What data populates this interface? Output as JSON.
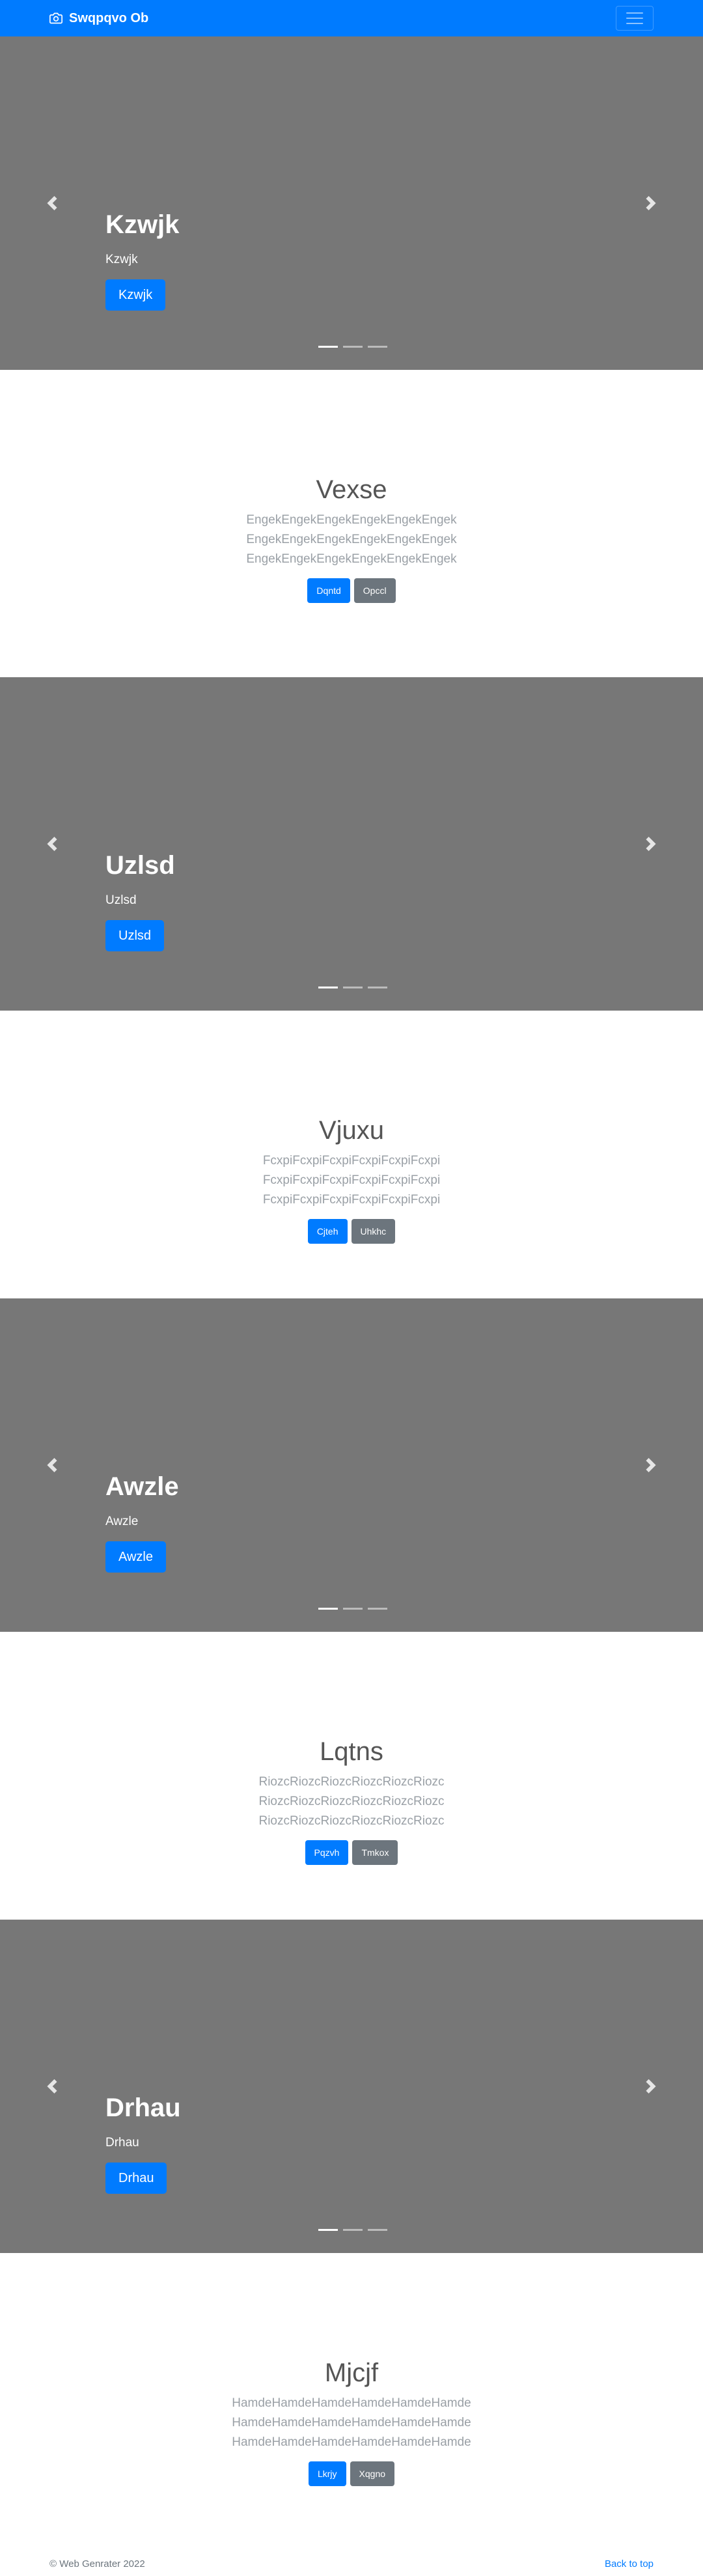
{
  "brand": {
    "name": "Swqpqvo Ob",
    "icon": "camera-icon"
  },
  "nav": {
    "toggler_icon": "hamburger-icon"
  },
  "carousels": [
    {
      "title": "Kzwjk",
      "subtitle": "Kzwjk",
      "button": "Kzwjk"
    },
    {
      "title": "Uzlsd",
      "subtitle": "Uzlsd",
      "button": "Uzlsd"
    },
    {
      "title": "Awzle",
      "subtitle": "Awzle",
      "button": "Awzle"
    },
    {
      "title": "Drhau",
      "subtitle": "Drhau",
      "button": "Drhau"
    }
  ],
  "sections": [
    {
      "heading": "Vexse",
      "text": "EngekEngekEngekEngekEngekEngek EngekEngekEngekEngekEngekEngek EngekEngekEngekEngekEngekEngek",
      "primary": "Dqntd",
      "secondary": "Opccl"
    },
    {
      "heading": "Vjuxu",
      "text": "FcxpiFcxpiFcxpiFcxpiFcxpiFcxpi FcxpiFcxpiFcxpiFcxpiFcxpiFcxpi FcxpiFcxpiFcxpiFcxpiFcxpiFcxpi",
      "primary": "Cjteh",
      "secondary": "Uhkhc"
    },
    {
      "heading": "Lqtns",
      "text": "RiozcRiozcRiozcRiozcRiozcRiozc RiozcRiozcRiozcRiozcRiozcRiozc RiozcRiozcRiozcRiozcRiozcRiozc",
      "primary": "Pqzvh",
      "secondary": "Tmkox"
    },
    {
      "heading": "Mjcjf",
      "text": "HamdeHamdeHamdeHamdeHamdeHamde HamdeHamdeHamdeHamdeHamdeHamde HamdeHamdeHamdeHamdeHamdeHamde",
      "primary": "Lkrjy",
      "secondary": "Xqgno"
    }
  ],
  "footer": {
    "copyright": "© Web Genrater 2022",
    "back_to_top": "Back to top"
  },
  "colors": {
    "primary": "#007bff",
    "secondary": "#6c757d",
    "carousel_bg": "#777777"
  }
}
